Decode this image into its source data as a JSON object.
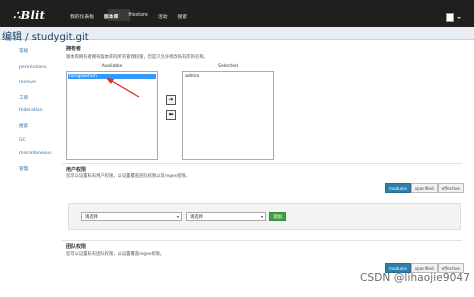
{
  "app": {
    "logo": "Blit",
    "nav": [
      "我的仪表板",
      "版本库",
      "filestore",
      "活动",
      "搜索"
    ],
    "active_nav": "版本库"
  },
  "page": {
    "title": "编辑 / studygit.git"
  },
  "sidebar": {
    "items": [
      {
        "label": "常规"
      },
      {
        "label": "permissions"
      },
      {
        "label": "receive"
      },
      {
        "label": "工单"
      },
      {
        "label": "federation"
      },
      {
        "label": "搜索"
      },
      {
        "label": "GC"
      },
      {
        "label": "miscellaneous"
      },
      {
        "label": "管理"
      }
    ]
  },
  "owners": {
    "title": "拥有者",
    "description": "版本库拥有者拥有版本库的所有管理权限，但是只允许修改私有库的名称。",
    "available_label": "Available",
    "selected_label": "Selected",
    "available_items": [
      "hongtaotian"
    ],
    "selected_items": [
      "admin"
    ],
    "move_right_icon": "arrow-right-icon",
    "move_left_icon": "arrow-left-icon"
  },
  "user_permissions": {
    "title": "用户权限",
    "description": "您可以设置私有用户权限，以设置覆盖团队权限以及regex权限。",
    "filters": [
      "modules",
      "specified",
      "effective"
    ],
    "active_filter": "modules",
    "select_user_placeholder": "请选择",
    "select_permission_placeholder": "请选择",
    "add_label": "添加"
  },
  "team_permissions": {
    "title": "团队权限",
    "description": "您可以设置私有团队权限，以设置覆盖regex权限。",
    "filters": [
      "modules",
      "specified",
      "effective"
    ],
    "active_filter": "modules"
  },
  "watermark": "CSDN @lihaojie9047",
  "colors": {
    "topbar": "#1f1f1f",
    "title": "#1a3e63",
    "link": "#3a6ea5",
    "selection": "#3399ff",
    "active_filter": "#2f7fae",
    "add_button": "#45a045"
  }
}
